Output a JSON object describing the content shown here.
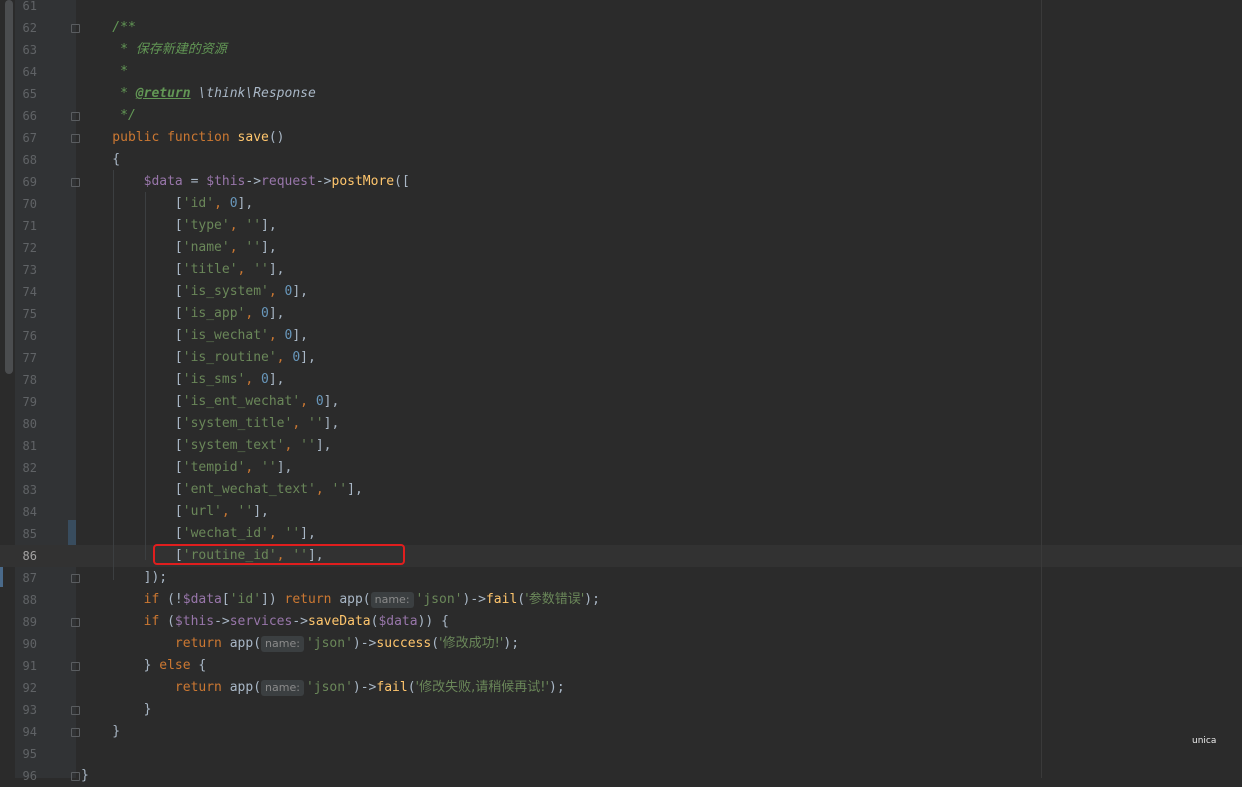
{
  "editor": {
    "lines": [
      {
        "num": "61",
        "segments": []
      },
      {
        "num": "62",
        "segments": [
          {
            "t": "    /**",
            "c": "cm"
          }
        ]
      },
      {
        "num": "63",
        "segments": [
          {
            "t": "     * ",
            "c": "cm"
          },
          {
            "t": "保存新建的资源",
            "c": "cm cjk"
          }
        ]
      },
      {
        "num": "64",
        "segments": [
          {
            "t": "     *",
            "c": "cm"
          }
        ]
      },
      {
        "num": "65",
        "segments": [
          {
            "t": "     * ",
            "c": "cm"
          },
          {
            "t": "@return",
            "c": "cmtag"
          },
          {
            "t": " \\think\\Response",
            "c": "cmtype"
          }
        ]
      },
      {
        "num": "66",
        "segments": [
          {
            "t": "     */",
            "c": "cm"
          }
        ]
      },
      {
        "num": "67",
        "segments": [
          {
            "t": "    public function ",
            "c": "kw"
          },
          {
            "t": "save",
            "c": "fn"
          },
          {
            "t": "()",
            "c": ""
          }
        ]
      },
      {
        "num": "68",
        "segments": [
          {
            "t": "    {",
            "c": ""
          }
        ]
      },
      {
        "num": "69",
        "segments": [
          {
            "t": "        ",
            "c": ""
          },
          {
            "t": "$data",
            "c": "var"
          },
          {
            "t": " = ",
            "c": ""
          },
          {
            "t": "$this",
            "c": "var"
          },
          {
            "t": "->",
            "c": ""
          },
          {
            "t": "request",
            "c": "var"
          },
          {
            "t": "->",
            "c": ""
          },
          {
            "t": "postMore",
            "c": "fn"
          },
          {
            "t": "([",
            "c": ""
          }
        ]
      },
      {
        "num": "70",
        "segments": [
          {
            "t": "            [",
            "c": ""
          },
          {
            "t": "'id'",
            "c": "str"
          },
          {
            "t": ", ",
            "c": "kw"
          },
          {
            "t": "0",
            "c": "num"
          },
          {
            "t": "],",
            "c": ""
          }
        ]
      },
      {
        "num": "71",
        "segments": [
          {
            "t": "            [",
            "c": ""
          },
          {
            "t": "'type'",
            "c": "str"
          },
          {
            "t": ", ",
            "c": "kw"
          },
          {
            "t": "''",
            "c": "str"
          },
          {
            "t": "],",
            "c": ""
          }
        ]
      },
      {
        "num": "72",
        "segments": [
          {
            "t": "            [",
            "c": ""
          },
          {
            "t": "'name'",
            "c": "str"
          },
          {
            "t": ", ",
            "c": "kw"
          },
          {
            "t": "''",
            "c": "str"
          },
          {
            "t": "],",
            "c": ""
          }
        ]
      },
      {
        "num": "73",
        "segments": [
          {
            "t": "            [",
            "c": ""
          },
          {
            "t": "'title'",
            "c": "str"
          },
          {
            "t": ", ",
            "c": "kw"
          },
          {
            "t": "''",
            "c": "str"
          },
          {
            "t": "],",
            "c": ""
          }
        ]
      },
      {
        "num": "74",
        "segments": [
          {
            "t": "            [",
            "c": ""
          },
          {
            "t": "'is_system'",
            "c": "str"
          },
          {
            "t": ", ",
            "c": "kw"
          },
          {
            "t": "0",
            "c": "num"
          },
          {
            "t": "],",
            "c": ""
          }
        ]
      },
      {
        "num": "75",
        "segments": [
          {
            "t": "            [",
            "c": ""
          },
          {
            "t": "'is_app'",
            "c": "str"
          },
          {
            "t": ", ",
            "c": "kw"
          },
          {
            "t": "0",
            "c": "num"
          },
          {
            "t": "],",
            "c": ""
          }
        ]
      },
      {
        "num": "76",
        "segments": [
          {
            "t": "            [",
            "c": ""
          },
          {
            "t": "'is_wechat'",
            "c": "str"
          },
          {
            "t": ", ",
            "c": "kw"
          },
          {
            "t": "0",
            "c": "num"
          },
          {
            "t": "],",
            "c": ""
          }
        ]
      },
      {
        "num": "77",
        "segments": [
          {
            "t": "            [",
            "c": ""
          },
          {
            "t": "'is_routine'",
            "c": "str"
          },
          {
            "t": ", ",
            "c": "kw"
          },
          {
            "t": "0",
            "c": "num"
          },
          {
            "t": "],",
            "c": ""
          }
        ]
      },
      {
        "num": "78",
        "segments": [
          {
            "t": "            [",
            "c": ""
          },
          {
            "t": "'is_sms'",
            "c": "str"
          },
          {
            "t": ", ",
            "c": "kw"
          },
          {
            "t": "0",
            "c": "num"
          },
          {
            "t": "],",
            "c": ""
          }
        ]
      },
      {
        "num": "79",
        "segments": [
          {
            "t": "            [",
            "c": ""
          },
          {
            "t": "'is_ent_wechat'",
            "c": "str"
          },
          {
            "t": ", ",
            "c": "kw"
          },
          {
            "t": "0",
            "c": "num"
          },
          {
            "t": "],",
            "c": ""
          }
        ]
      },
      {
        "num": "80",
        "segments": [
          {
            "t": "            [",
            "c": ""
          },
          {
            "t": "'system_title'",
            "c": "str"
          },
          {
            "t": ", ",
            "c": "kw"
          },
          {
            "t": "''",
            "c": "str"
          },
          {
            "t": "],",
            "c": ""
          }
        ]
      },
      {
        "num": "81",
        "segments": [
          {
            "t": "            [",
            "c": ""
          },
          {
            "t": "'system_text'",
            "c": "str"
          },
          {
            "t": ", ",
            "c": "kw"
          },
          {
            "t": "''",
            "c": "str"
          },
          {
            "t": "],",
            "c": ""
          }
        ]
      },
      {
        "num": "82",
        "segments": [
          {
            "t": "            [",
            "c": ""
          },
          {
            "t": "'tempid'",
            "c": "str"
          },
          {
            "t": ", ",
            "c": "kw"
          },
          {
            "t": "''",
            "c": "str"
          },
          {
            "t": "],",
            "c": ""
          }
        ]
      },
      {
        "num": "83",
        "segments": [
          {
            "t": "            [",
            "c": ""
          },
          {
            "t": "'ent_wechat_text'",
            "c": "str"
          },
          {
            "t": ", ",
            "c": "kw"
          },
          {
            "t": "''",
            "c": "str"
          },
          {
            "t": "],",
            "c": ""
          }
        ]
      },
      {
        "num": "84",
        "segments": [
          {
            "t": "            [",
            "c": ""
          },
          {
            "t": "'url'",
            "c": "str"
          },
          {
            "t": ", ",
            "c": "kw"
          },
          {
            "t": "''",
            "c": "str"
          },
          {
            "t": "],",
            "c": ""
          }
        ]
      },
      {
        "num": "85",
        "segments": [
          {
            "t": "            [",
            "c": ""
          },
          {
            "t": "'wechat_id'",
            "c": "str"
          },
          {
            "t": ", ",
            "c": "kw"
          },
          {
            "t": "''",
            "c": "str"
          },
          {
            "t": "],",
            "c": ""
          }
        ]
      },
      {
        "num": "86",
        "current": true,
        "segments": [
          {
            "t": "            [",
            "c": ""
          },
          {
            "t": "'routine_id'",
            "c": "str"
          },
          {
            "t": ", ",
            "c": "kw"
          },
          {
            "t": "''",
            "c": "str"
          },
          {
            "t": "],",
            "c": ""
          }
        ]
      },
      {
        "num": "87",
        "segments": [
          {
            "t": "        ]);",
            "c": ""
          }
        ]
      },
      {
        "num": "88",
        "segments": [
          {
            "t": "        if ",
            "c": "kw"
          },
          {
            "t": "(!",
            "c": ""
          },
          {
            "t": "$data",
            "c": "var"
          },
          {
            "t": "[",
            "c": ""
          },
          {
            "t": "'id'",
            "c": "str"
          },
          {
            "t": "]) ",
            "c": ""
          },
          {
            "t": "return ",
            "c": "kw"
          },
          {
            "t": "app(",
            "c": ""
          },
          {
            "hint": "name:"
          },
          {
            "t": "'json'",
            "c": "str"
          },
          {
            "t": ")->",
            "c": ""
          },
          {
            "t": "fail",
            "c": "fn"
          },
          {
            "t": "(",
            "c": ""
          },
          {
            "t": "'参数错误'",
            "c": "str cjk"
          },
          {
            "t": ");",
            "c": ""
          }
        ]
      },
      {
        "num": "89",
        "segments": [
          {
            "t": "        if ",
            "c": "kw"
          },
          {
            "t": "(",
            "c": ""
          },
          {
            "t": "$this",
            "c": "var"
          },
          {
            "t": "->",
            "c": ""
          },
          {
            "t": "services",
            "c": "var"
          },
          {
            "t": "->",
            "c": ""
          },
          {
            "t": "saveData",
            "c": "fn"
          },
          {
            "t": "(",
            "c": ""
          },
          {
            "t": "$data",
            "c": "var"
          },
          {
            "t": ")) {",
            "c": ""
          }
        ]
      },
      {
        "num": "90",
        "segments": [
          {
            "t": "            return ",
            "c": "kw"
          },
          {
            "t": "app(",
            "c": ""
          },
          {
            "hint": "name:"
          },
          {
            "t": "'json'",
            "c": "str"
          },
          {
            "t": ")->",
            "c": ""
          },
          {
            "t": "success",
            "c": "fn"
          },
          {
            "t": "(",
            "c": ""
          },
          {
            "t": "'修改成功!'",
            "c": "str cjk"
          },
          {
            "t": ");",
            "c": ""
          }
        ]
      },
      {
        "num": "91",
        "segments": [
          {
            "t": "        } ",
            "c": ""
          },
          {
            "t": "else ",
            "c": "kw"
          },
          {
            "t": "{",
            "c": ""
          }
        ]
      },
      {
        "num": "92",
        "segments": [
          {
            "t": "            return ",
            "c": "kw"
          },
          {
            "t": "app(",
            "c": ""
          },
          {
            "hint": "name:"
          },
          {
            "t": "'json'",
            "c": "str"
          },
          {
            "t": ")->",
            "c": ""
          },
          {
            "t": "fail",
            "c": "fn"
          },
          {
            "t": "(",
            "c": ""
          },
          {
            "t": "'修改失败,请稍候再试!'",
            "c": "str cjk"
          },
          {
            "t": ");",
            "c": ""
          }
        ]
      },
      {
        "num": "93",
        "segments": [
          {
            "t": "        }",
            "c": ""
          }
        ]
      },
      {
        "num": "94",
        "segments": [
          {
            "t": "    }",
            "c": ""
          }
        ]
      },
      {
        "num": "95",
        "segments": []
      },
      {
        "num": "96",
        "segments": [
          {
            "t": "}",
            "c": ""
          }
        ]
      }
    ],
    "fold_markers_lines": [
      "62",
      "66",
      "67",
      "69",
      "87",
      "89",
      "91",
      "93",
      "94",
      "96"
    ],
    "highlighted_line": "86"
  },
  "watermark": "unica"
}
